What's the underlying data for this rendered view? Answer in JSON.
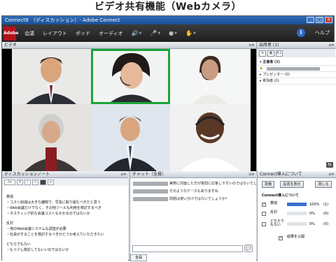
{
  "heading": "ビデオ共有機能（Webカメラ）",
  "window": {
    "title": "Connect9　（ディスカッション）- Adobe Connect",
    "logo": "Adobe"
  },
  "menubar": {
    "items": [
      "会議",
      "レイアウト",
      "ポッド",
      "オーディオ"
    ],
    "help": "ヘルプ"
  },
  "video_pod": {
    "title": "ビデオ",
    "active_speaker_color": "#19a63a"
  },
  "attendees_pod": {
    "title": "出席者 (1)",
    "hosts": "主催者 (1)",
    "presenters": "プレゼンター (0)",
    "participants": "参加者 (0)"
  },
  "notes_pod": {
    "title": "ディスカッションノート",
    "lines": [
      "賛成",
      "・コスト削減は大きな課題で、早急に取り組むべきだと思う",
      "・Web会議だけでなく、その他ツールも利用を検討するべき",
      "・ネスティング的な会議コストもかかるのではないか",
      "",
      "反対",
      "・他のWeb会議システムも調査が必要",
      "・社員がすることを検討するべきかどうか考えていただきたい",
      "",
      "どちらでもない",
      "・もう少し検討してもいいのではないか"
    ]
  },
  "chat_pod": {
    "title": "チャット（全員）",
    "messages": [
      "実際に対面した方が質問に応答しやすいのではないでしょうか",
      "そのようなケースもありますね",
      "問題は使い分けではないでしょうか？"
    ],
    "tab": "全員",
    "send_icon": "speech-bubble-icon"
  },
  "poll_pod": {
    "title": "Connect導入について",
    "buttons": [
      "準備",
      "投票を表示",
      "閉じる"
    ],
    "question": "Connect導入について",
    "options": [
      {
        "label": "賛成",
        "percent": 100,
        "percent_label": "100%",
        "count": "(1)",
        "checked": true
      },
      {
        "label": "反対",
        "percent": 0,
        "percent_label": "0%",
        "count": "(0)",
        "checked": false
      },
      {
        "label": "どちらでもない",
        "percent": 0,
        "percent_label": "0%",
        "count": "(0)",
        "checked": false
      }
    ],
    "publish_label": "結果を公開",
    "publish_checked": true
  }
}
